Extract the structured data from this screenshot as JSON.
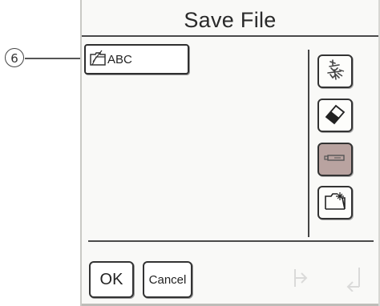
{
  "callout": {
    "number": "6"
  },
  "window": {
    "title": "Save File"
  },
  "file_list": {
    "items": [
      {
        "label": "ABC",
        "icon": "folder-icon"
      }
    ]
  },
  "side_toolbar": {
    "buttons": [
      {
        "icon": "decorative-pattern-icon",
        "active": false
      },
      {
        "icon": "eraser-icon",
        "active": false
      },
      {
        "icon": "usb-media-icon",
        "active": true
      },
      {
        "icon": "new-folder-icon",
        "active": false
      }
    ]
  },
  "footer": {
    "ok_label": "OK",
    "cancel_label": "Cancel",
    "faint_icons": [
      "arrow-left-icon",
      "arrow-right-icon"
    ]
  },
  "colors": {
    "active_button": "#b9a3a0",
    "border": "#333333",
    "background": "#f9f9f7"
  }
}
